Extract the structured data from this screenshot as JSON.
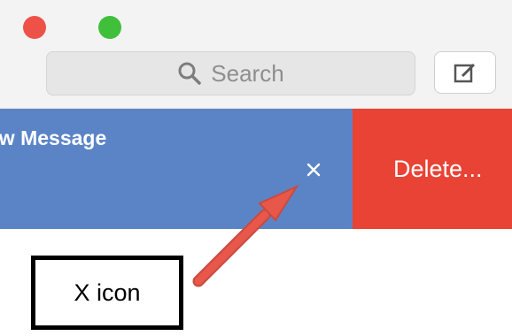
{
  "colors": {
    "close": "#ee5148",
    "minimize": "#f3b33b",
    "zoom": "#3fbf3a",
    "row": "#5b84c7",
    "delete": "#e84335",
    "arrow": "#e7574a"
  },
  "window": {
    "buttons": [
      "close",
      "minimize",
      "zoom"
    ]
  },
  "toolbar": {
    "search_placeholder": "Search",
    "compose_icon": "compose-icon"
  },
  "message_row": {
    "title": "ew Message",
    "close_icon": "x-icon",
    "delete_label": "Delete..."
  },
  "annotation": {
    "label": "X icon"
  }
}
